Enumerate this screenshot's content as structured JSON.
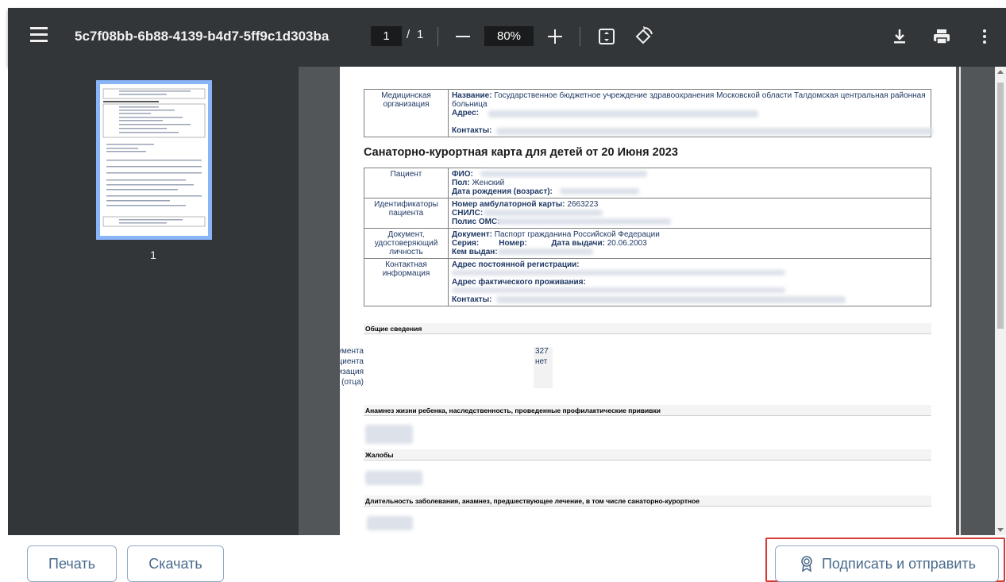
{
  "toolbar": {
    "file_name": "5c7f08bb-6b88-4139-b4d7-5ff9c1d303ba",
    "current_page": "1",
    "page_separator": "/",
    "total_pages": "1",
    "zoom": "80%"
  },
  "sidebar": {
    "thumbnail_page_number": "1"
  },
  "document": {
    "org_table": {
      "label": "Медицинская организация",
      "name_key": "Название:",
      "name_value": "Государственное бюджетное учреждение здравоохранения Московской области Талдомская центральная районная больница",
      "address_key": "Адрес:",
      "contacts_key": "Контакты:"
    },
    "heading": "Санаторно-курортная карта для детей от 20 Июня 2023",
    "patient_table": {
      "patient_label": "Пациент",
      "fio_key": "ФИО:",
      "sex_key": "Пол:",
      "sex_value": "Женский",
      "dob_key": "Дата рождения (возраст):",
      "ids_label": "Идентификаторы пациента",
      "amb_card_key": "Номер амбулаторной карты:",
      "amb_card_value": "2663223",
      "snils_key": "СНИЛС:",
      "oms_key": "Полис ОМС:",
      "doc_label": "Документ, удостоверяющий личность",
      "doc_key": "Документ:",
      "doc_value": "Паспорт гражданина Российской Федерации",
      "series_key": "Серия:",
      "number_key": "Номер:",
      "issue_date_key": "Дата выдачи:",
      "issue_date_value": "20.06.2003",
      "issued_by_key": "Кем выдан:",
      "contact_label": "Контактная информация",
      "reg_addr_key": "Адрес постоянной регистрации:",
      "fact_addr_key": "Адрес фактического проживания:",
      "contacts_key": "Контакты:"
    },
    "general_section": "Общие сведения",
    "general_info": [
      {
        "label": "Номер документа",
        "value": "327"
      },
      {
        "label": "Необходимость сопровождения пациента",
        "value": "нет"
      },
      {
        "label": "Образовательная организация",
        "value": ""
      },
      {
        "label": "Место работы матери (отца)",
        "value": ""
      }
    ],
    "anamnesis_section": "Анамнез жизни ребенка, наследственность, проведенные профилактические прививки",
    "complaints_section": "Жалобы",
    "duration_section": "Длительность заболевания, анамнез, предшествующее лечение, в том числе санаторно-курортное"
  },
  "buttons": {
    "print": "Печать",
    "download": "Скачать",
    "sign_and_send": "Подписать и отправить"
  },
  "colors": {
    "toolbar_bg": "#323639",
    "viewer_bg": "#525659",
    "thumbnail_border": "#8ab4f8",
    "button_text": "#4a6a8c",
    "highlight_border": "#d33a3a"
  },
  "icons": [
    "menu-icon",
    "minus-icon",
    "plus-icon",
    "fit-page-icon",
    "rotate-icon",
    "download-icon",
    "print-icon",
    "more-vert-icon",
    "sign-certificate-icon"
  ]
}
